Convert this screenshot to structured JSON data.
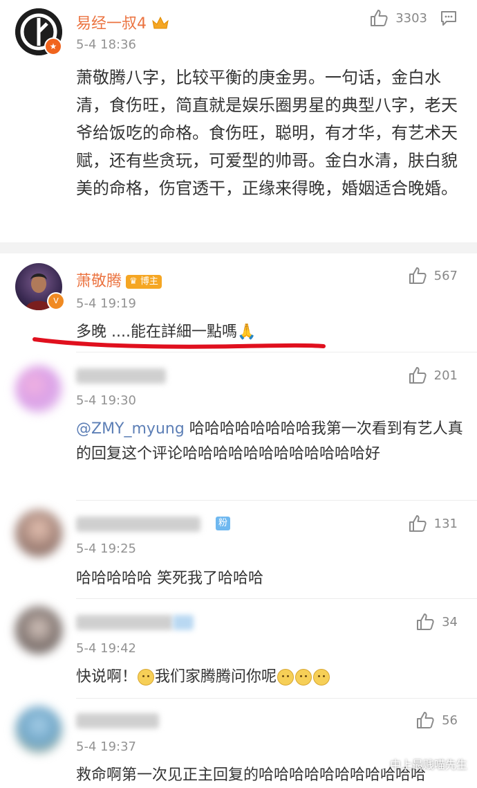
{
  "main_comment": {
    "user_name": "易经一叔4",
    "time": "5-4 18:36",
    "likes": "3303",
    "text": "萧敬腾八字，比较平衡的庚金男。一句话，金白水清，食伤旺，简直就是娱乐圈男星的典型八字，老天爷给饭吃的命格。食伤旺，聪明，有才华，有艺术天赋，还有些贪玩，可爱型的帅哥。金白水清，肤白貌美的命格，伤官透干，正缘来得晚，婚姻适合晚婚。"
  },
  "replies": [
    {
      "user_name": "萧敬腾",
      "badge": "博主",
      "time": "5-4 19:19",
      "likes": "567",
      "text": "多晚 ....能在詳細一點嗎🙏"
    },
    {
      "time": "5-4 19:30",
      "likes": "201",
      "mention": "@ZMY_myung",
      "text": " 哈哈哈哈哈哈哈哈我第一次看到有艺人真的回复这个评论哈哈哈哈哈哈哈哈哈哈哈哈好"
    },
    {
      "badge": "粉",
      "time": "5-4 19:25",
      "likes": "131",
      "text": "哈哈哈哈哈 笑死我了哈哈哈"
    },
    {
      "time": "5-4 19:42",
      "likes": "34",
      "text_a": "快说啊！",
      "text_b": "我们家腾腾问你呢"
    },
    {
      "time": "5-4 19:37",
      "likes": "56",
      "text": "救命啊第一次见正主回复的哈哈哈哈哈哈哈哈哈哈哈"
    }
  ],
  "watermark": "中上最贱喵先生",
  "colors": {
    "name_orange": "#eb7340",
    "mention_blue": "#5d7fb6",
    "annotation_red": "#e0101e"
  }
}
